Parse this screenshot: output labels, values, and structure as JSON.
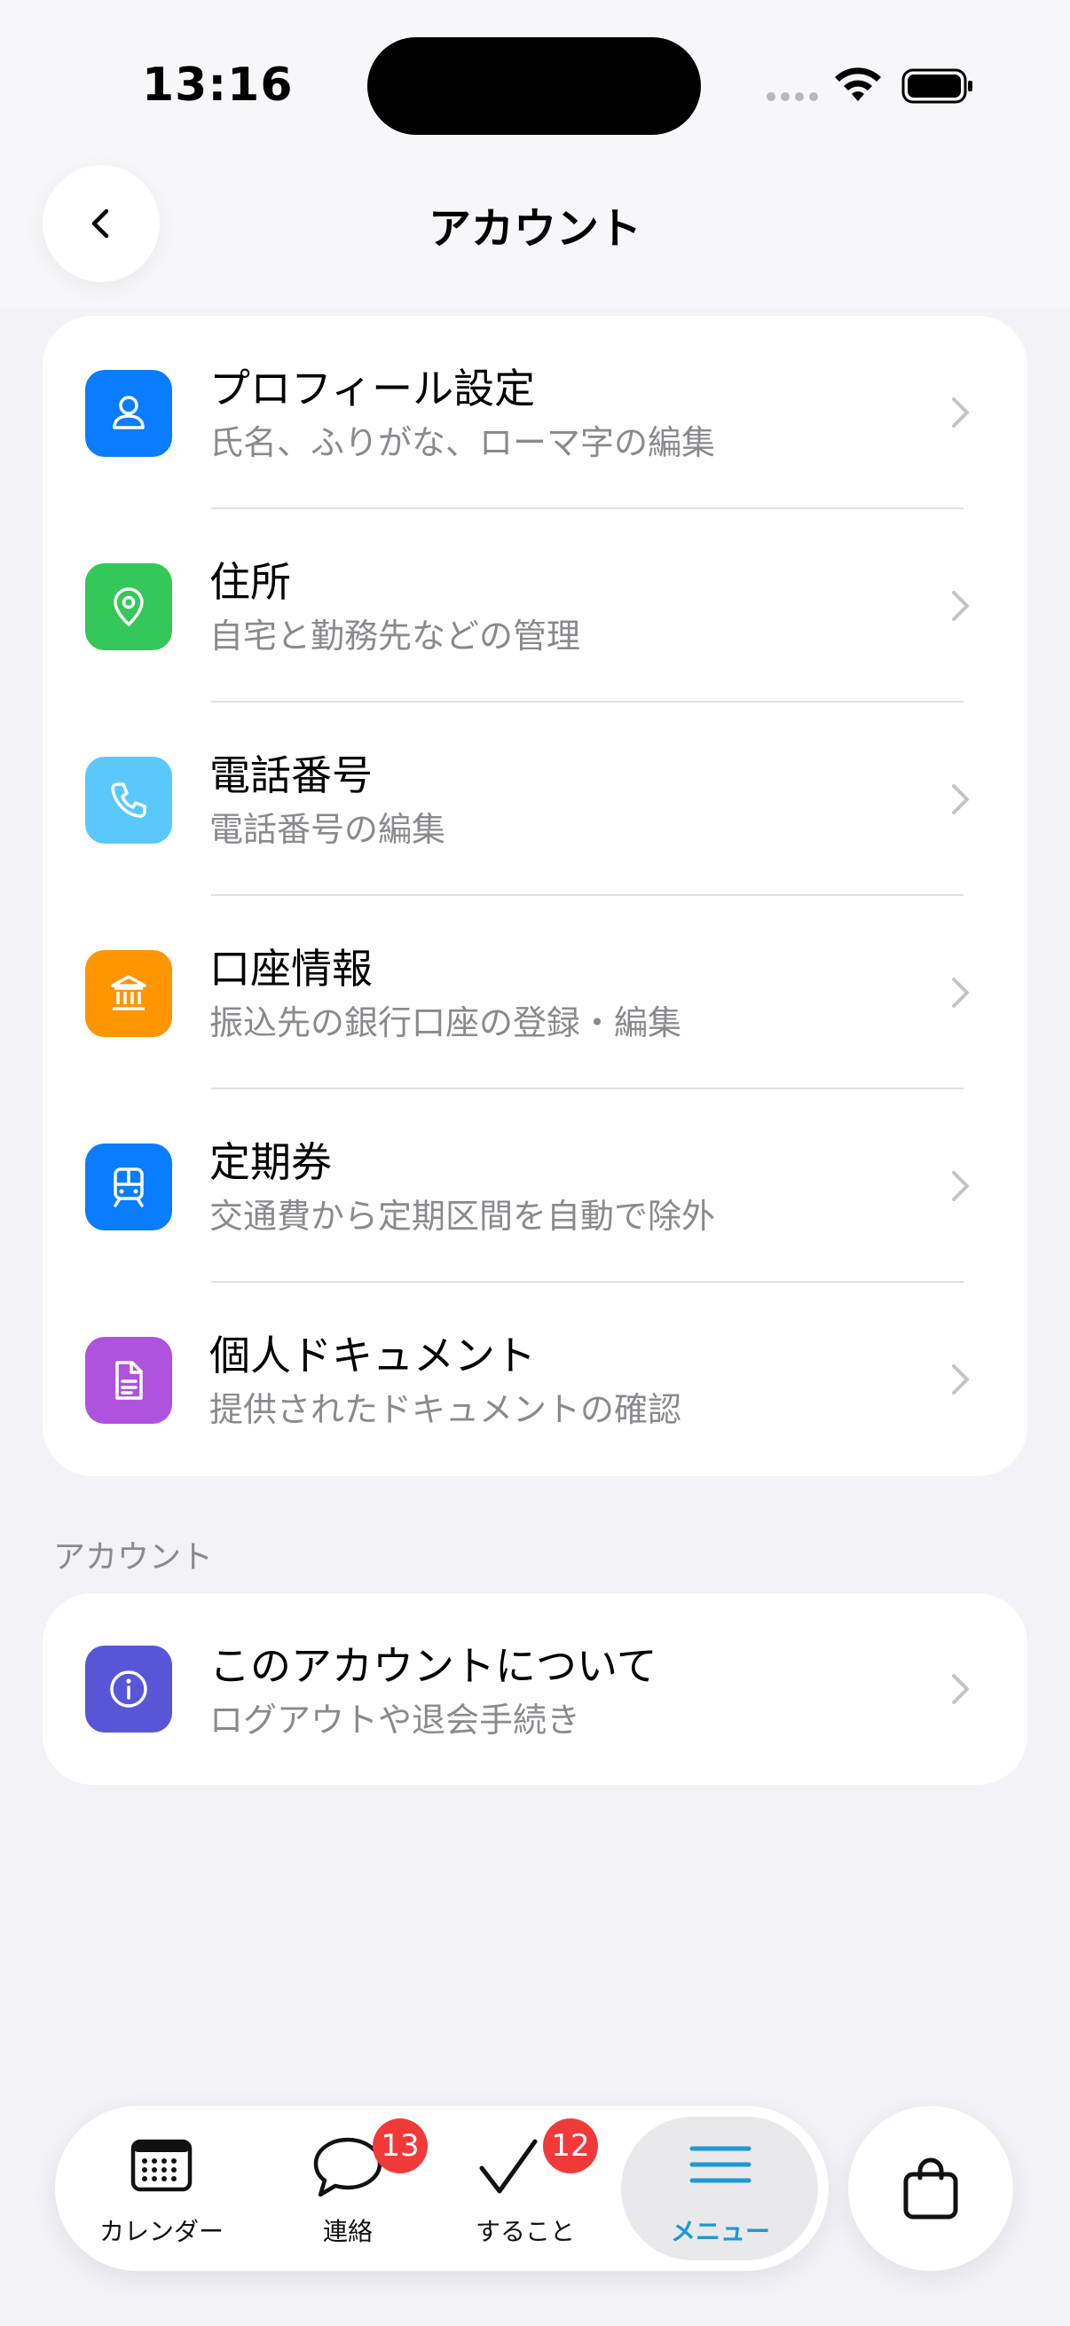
{
  "status_bar": {
    "time": "13:16"
  },
  "header": {
    "title": "アカウント"
  },
  "menu_items": [
    {
      "title": "プロフィール設定",
      "subtitle": "氏名、ふりがな、ローマ字の編集",
      "icon": "person-icon",
      "color": "#0a7cff"
    },
    {
      "title": "住所",
      "subtitle": "自宅と勤務先などの管理",
      "icon": "location-pin-icon",
      "color": "#34c759"
    },
    {
      "title": "電話番号",
      "subtitle": "電話番号の編集",
      "icon": "phone-icon",
      "color": "#5ac8fa"
    },
    {
      "title": "口座情報",
      "subtitle": "振込先の銀行口座の登録・編集",
      "icon": "bank-icon",
      "color": "#ff9500"
    },
    {
      "title": "定期券",
      "subtitle": "交通費から定期区間を自動で除外",
      "icon": "train-icon",
      "color": "#0a7cff"
    },
    {
      "title": "個人ドキュメント",
      "subtitle": "提供されたドキュメントの確認",
      "icon": "document-icon",
      "color": "#af52de"
    }
  ],
  "account_section": {
    "label": "アカウント",
    "item": {
      "title": "このアカウントについて",
      "subtitle": "ログアウトや退会手続き",
      "icon": "info-icon",
      "color": "#5856d6"
    }
  },
  "tabbar": {
    "tabs": [
      {
        "label": "カレンダー",
        "icon": "calendar-icon"
      },
      {
        "label": "連絡",
        "icon": "chat-bubble-icon",
        "badge": "13"
      },
      {
        "label": "すること",
        "icon": "checkmark-icon",
        "badge": "12"
      },
      {
        "label": "メニュー",
        "icon": "hamburger-menu-icon",
        "active": true
      }
    ],
    "active_color": "#1a9ad6",
    "cart_icon": "shopping-bag-icon"
  }
}
